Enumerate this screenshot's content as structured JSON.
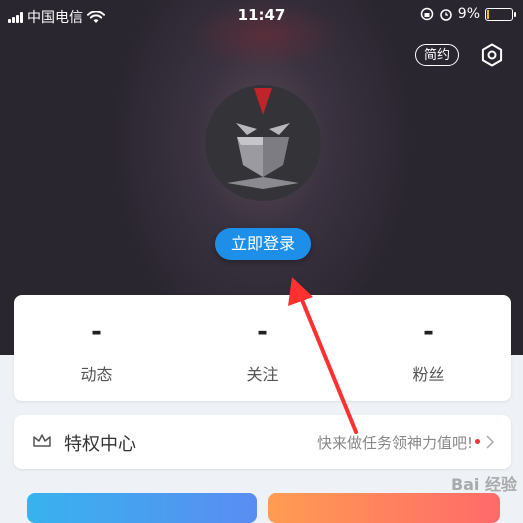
{
  "status_bar": {
    "carrier": "中国电信",
    "time": "11:47",
    "battery_percent": "9%",
    "battery_level": 0.09
  },
  "header": {
    "simple_mode_label": "简约",
    "settings_icon": "gear-icon"
  },
  "profile": {
    "avatar_icon": "masked-hero-avatar",
    "login_label": "立即登录"
  },
  "stats": [
    {
      "value": "-",
      "label": "动态"
    },
    {
      "value": "-",
      "label": "关注"
    },
    {
      "value": "-",
      "label": "粉丝"
    }
  ],
  "privilege": {
    "title": "特权中心",
    "hint": "快来做任务领神力值吧!",
    "icon": "crown-icon"
  },
  "watermark": {
    "text": "Bai 经验"
  },
  "colors": {
    "accent": "#1e8fe8",
    "annotation_arrow": "#ff3030"
  }
}
